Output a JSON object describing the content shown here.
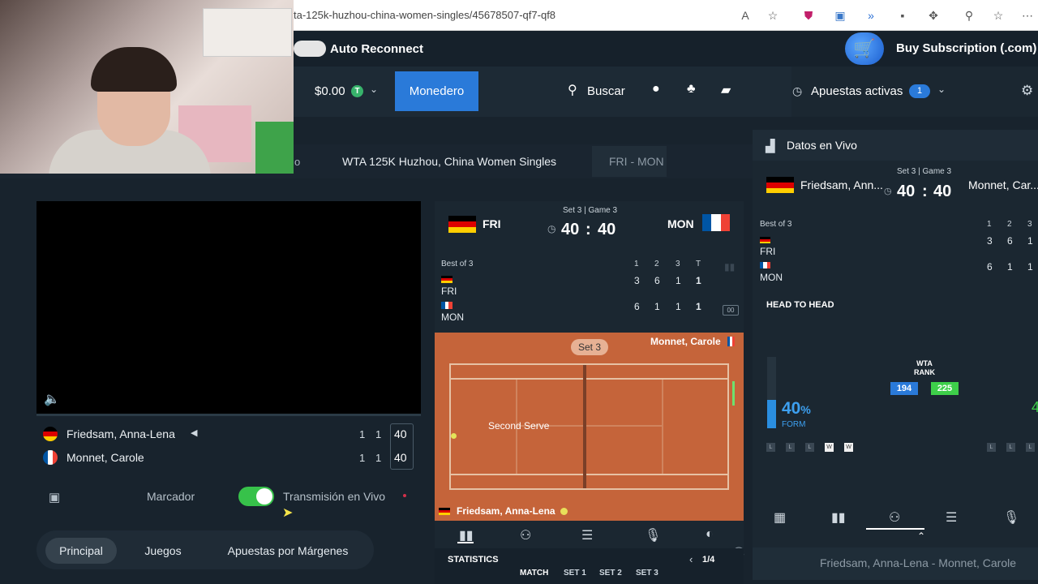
{
  "browser": {
    "url": "ta-125k-huzhou-china-women-singles/45678507-qf7-qf8",
    "icons": [
      "read-aloud-icon",
      "favorite-star-icon",
      "shield-extension-icon",
      "screenshot-extension-icon",
      "translate-extension-icon",
      "extension-badge-icon",
      "puzzle-extension-icon",
      "profile-extension-icon",
      "collections-icon",
      "more-icon"
    ]
  },
  "topbar": {
    "auto_reconnect": "Auto Reconnect",
    "buy_subscription": "Buy Subscription (.com)"
  },
  "nav": {
    "balance": "$0.00",
    "currency_badge": "T",
    "wallet_button": "Monedero",
    "search_label": "Buscar",
    "active_bets_label": "Apuestas activas",
    "active_bets_count": "1"
  },
  "breadcrumb": {
    "partial": "o",
    "tournament": "WTA 125K Huzhou, China Women Singles",
    "match_short": "FRI - MON"
  },
  "player_panel": {
    "players": [
      {
        "name": "Friedsam, Anna-Lena",
        "serving": true,
        "s1": "1",
        "s2": "1",
        "points": "40"
      },
      {
        "name": "Monnet, Carole",
        "serving": false,
        "s1": "1",
        "s2": "1",
        "points": "40"
      }
    ],
    "scoreboard_label": "Marcador",
    "live_stream_label": "Transmisión en Vivo",
    "toggle_on": true,
    "tabs": [
      "Principal",
      "Juegos",
      "Apuestas por Márgenes"
    ],
    "active_tab": "Principal"
  },
  "scoreboard": {
    "set_game": "Set 3 | Game 3",
    "home_abbr": "FRI",
    "away_abbr": "MON",
    "home_points": "40",
    "away_points": "40",
    "best_of": "Best of 3",
    "headers": [
      "1",
      "2",
      "3",
      "T"
    ],
    "rows": [
      {
        "abbr": "FRI",
        "sets": [
          "3",
          "6",
          "1"
        ],
        "total": "1"
      },
      {
        "abbr": "MON",
        "sets": [
          "6",
          "1",
          "1"
        ],
        "total": "1"
      }
    ],
    "court": {
      "set_pill": "Set 3",
      "top_player": "Monnet, Carole",
      "status": "Second Serve",
      "bottom_player": "Friedsam, Anna-Lena"
    },
    "stats": {
      "title": "STATISTICS",
      "page": "1/4",
      "tabs": [
        "MATCH",
        "SET 1",
        "SET 2",
        "SET 3"
      ]
    }
  },
  "live_data": {
    "title": "Datos en Vivo",
    "set_game": "Set 3 | Game 3",
    "home_name": "Friedsam, Ann...",
    "away_name": "Monnet, Car...",
    "home_points": "40",
    "away_points": "40",
    "best_of": "Best of 3",
    "headers": [
      "1",
      "2",
      "3"
    ],
    "rows": [
      {
        "abbr": "FRI",
        "sets": [
          "3",
          "6",
          "1"
        ]
      },
      {
        "abbr": "MON",
        "sets": [
          "6",
          "1",
          "1"
        ]
      }
    ],
    "h2h_title": "HEAD TO HEAD",
    "rank_label": "WTA\nRANK",
    "rank_label_1": "WTA",
    "rank_label_2": "RANK",
    "rank_home": "194",
    "rank_away": "225",
    "form_value": "40",
    "form_unit": "%",
    "form_label": "FORM",
    "form_home": [
      "L",
      "L",
      "L",
      "W",
      "W"
    ],
    "form_away": [
      "L",
      "L",
      "L"
    ],
    "footer": "Friedsam, Anna-Lena - Monnet, Carole"
  },
  "colors": {
    "accent_blue": "#2a7ad9",
    "toggle_green": "#37c24a",
    "clay": "#c5643a",
    "rank_green": "#3ecf4a"
  }
}
